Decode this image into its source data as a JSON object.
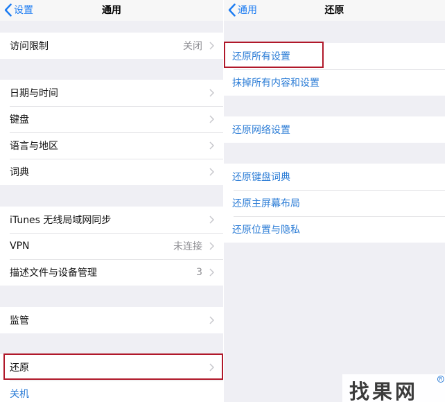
{
  "left": {
    "back_label": "设置",
    "title": "通用",
    "group1": [
      {
        "label": "访问限制",
        "value": "关闭"
      }
    ],
    "group2": [
      {
        "label": "日期与时间"
      },
      {
        "label": "键盘"
      },
      {
        "label": "语言与地区"
      },
      {
        "label": "词典"
      }
    ],
    "group3": [
      {
        "label": "iTunes 无线局域网同步"
      },
      {
        "label": "VPN",
        "value": "未连接"
      },
      {
        "label": "描述文件与设备管理",
        "value": "3"
      }
    ],
    "group4": [
      {
        "label": "监管"
      }
    ],
    "group5": [
      {
        "label": "还原"
      },
      {
        "label": "关机"
      }
    ]
  },
  "right": {
    "back_label": "通用",
    "title": "还原",
    "group1": [
      {
        "label": "还原所有设置"
      },
      {
        "label": "抹掉所有内容和设置"
      }
    ],
    "group2": [
      {
        "label": "还原网络设置"
      }
    ],
    "group3": [
      {
        "label": "还原键盘词典"
      },
      {
        "label": "还原主屏幕布局"
      },
      {
        "label": "还原位置与隐私"
      }
    ]
  },
  "watermark": {
    "text": "找果网",
    "reg": "R"
  },
  "colors": {
    "accent": "#1a7bf2",
    "highlight": "#b0182a",
    "background": "#efeff4"
  },
  "icons": {
    "back": "chevron-left-icon",
    "disclosure": "chevron-right-icon"
  }
}
